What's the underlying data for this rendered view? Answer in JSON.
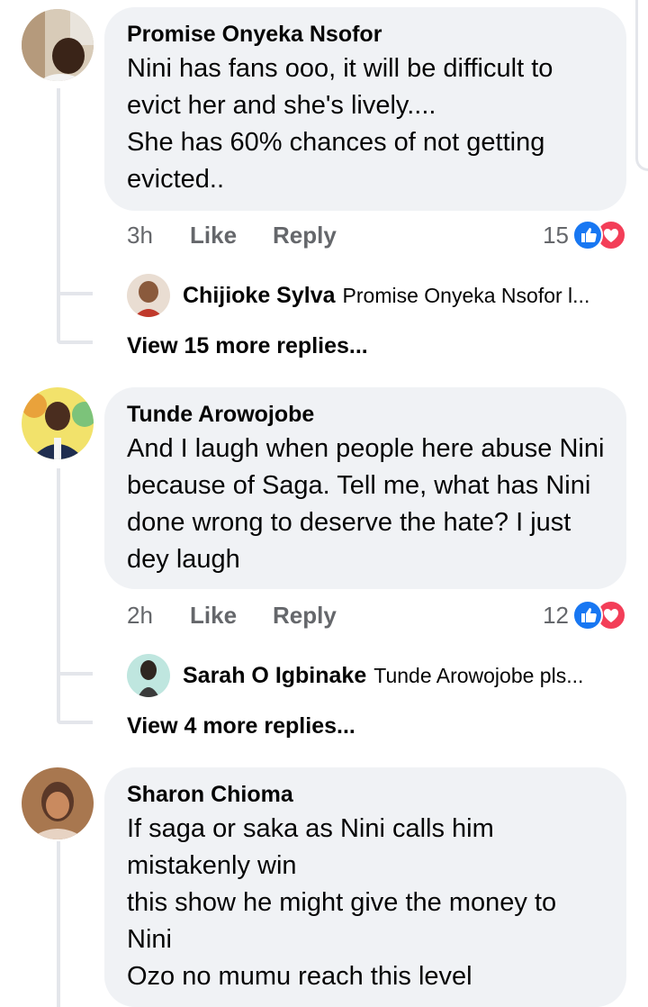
{
  "comments": [
    {
      "author": "Promise Onyeka Nsofor",
      "text": "Nini has fans ooo, it will be difficult to evict her and  she's lively....\nShe has 60% chances of not getting evicted..",
      "time": "3h",
      "like_label": "Like",
      "reply_label": "Reply",
      "reaction_count": "15",
      "reply_preview": {
        "author": "Chijioke Sylva",
        "text": "Promise Onyeka Nsofor l..."
      },
      "more_replies": "View 15 more replies..."
    },
    {
      "author": "Tunde Arowojobe",
      "text": "And I laugh when people here abuse Nini because of Saga. Tell me, what has Nini done wrong to deserve the hate?  I just dey laugh",
      "time": "2h",
      "like_label": "Like",
      "reply_label": "Reply",
      "reaction_count": "12",
      "reply_preview": {
        "author": "Sarah O Igbinake",
        "text": "Tunde Arowojobe pls..."
      },
      "more_replies": "View 4 more replies..."
    },
    {
      "author": "Sharon Chioma",
      "text": "If saga or saka as Nini calls him mistakenly win\n this show he might give the money to Nini\nOzo no mumu reach this level"
    }
  ],
  "icons": {
    "like": "thumbs-up-icon",
    "love": "heart-icon"
  },
  "colors": {
    "like": "#1877f2",
    "love": "#f33e58",
    "bubble": "#f0f2f5",
    "meta": "#65676b"
  }
}
